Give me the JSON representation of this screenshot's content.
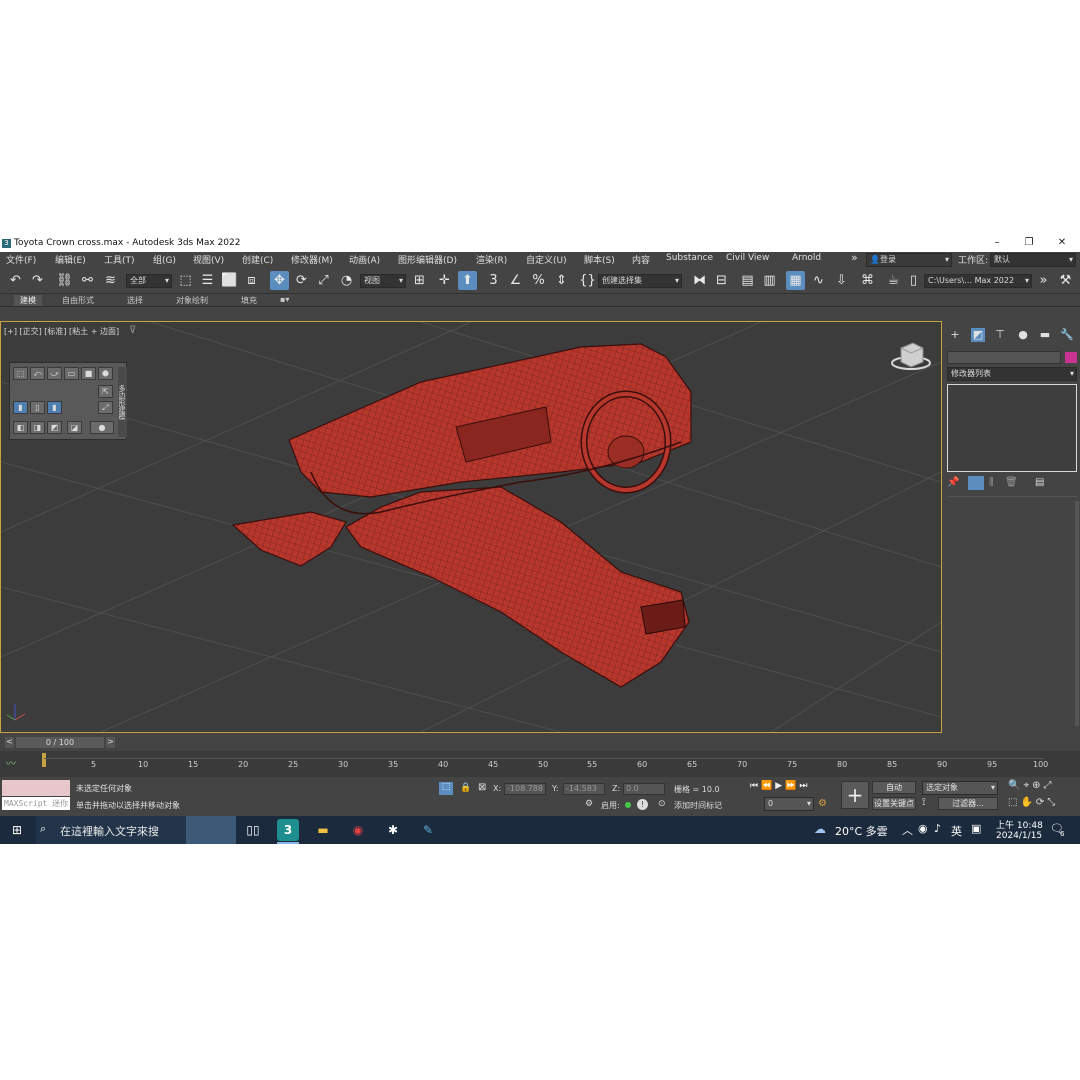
{
  "window": {
    "title": "Toyota Crown cross.max - Autodesk 3ds Max 2022",
    "app_icon": "3",
    "minimize": "–",
    "maximize": "❐",
    "close": "✕"
  },
  "menu": [
    "文件(F)",
    "编辑(E)",
    "工具(T)",
    "组(G)",
    "视图(V)",
    "创建(C)",
    "修改器(M)",
    "动画(A)",
    "图形编辑器(D)",
    "渲染(R)",
    "自定义(U)",
    "脚本(S)",
    "内容",
    "Substance",
    "Civil View",
    "Arnold"
  ],
  "menu_more": "»",
  "login": "登录",
  "workspace_label": "工作区:",
  "workspace_value": "默认",
  "toolbar": {
    "selection_filter": "全部",
    "ref_coord": "视图",
    "named_selection": "创建选择集",
    "project_path": "C:\\Users\\… Max 2022",
    "snap_label": "3",
    "percent_label": "%"
  },
  "ribbon_tabs": [
    "建模",
    "自由形式",
    "选择",
    "对象绘制",
    "填充"
  ],
  "viewport": {
    "label": "[+] [正交] [标准] [粘土 + 边面]",
    "mini_panel_title": "多边形建模"
  },
  "command_panel": {
    "modifier_list": "修改器列表"
  },
  "time": {
    "frame_display": "0 / 100",
    "ticks": [
      "5",
      "10",
      "15",
      "20",
      "25",
      "30",
      "35",
      "40",
      "45",
      "50",
      "55",
      "60",
      "65",
      "70",
      "75",
      "80",
      "85",
      "90",
      "95",
      "100"
    ]
  },
  "status": {
    "maxscript_placeholder": "MAXScript 迷你",
    "line1": "未选定任何对象",
    "line2": "单击并拖动以选择并移动对象",
    "x_label": "X:",
    "x_value": "-108.788",
    "y_label": "Y:",
    "y_value": "-14.583",
    "z_label": "Z:",
    "z_value": "0.0",
    "grid": "栅格 = 10.0",
    "enable": "启用:",
    "add_time_tag": "添加时间标记",
    "auto_key": "自动",
    "set_key": "设置关键点",
    "selected_object": "选定对象",
    "filters": "过滤器...",
    "current_frame": "0"
  },
  "taskbar": {
    "search_placeholder": "在這裡輸入文字來搜",
    "weather": "20°C 多雲",
    "ime": "英",
    "time": "上午 10:48",
    "date": "2024/1/15",
    "notifications": "6"
  },
  "colors": {
    "model_red": "#b8372c",
    "viewport_border": "#c8a242",
    "active_blue": "#5c8dbf",
    "taskbar": "#1b2a3d"
  }
}
